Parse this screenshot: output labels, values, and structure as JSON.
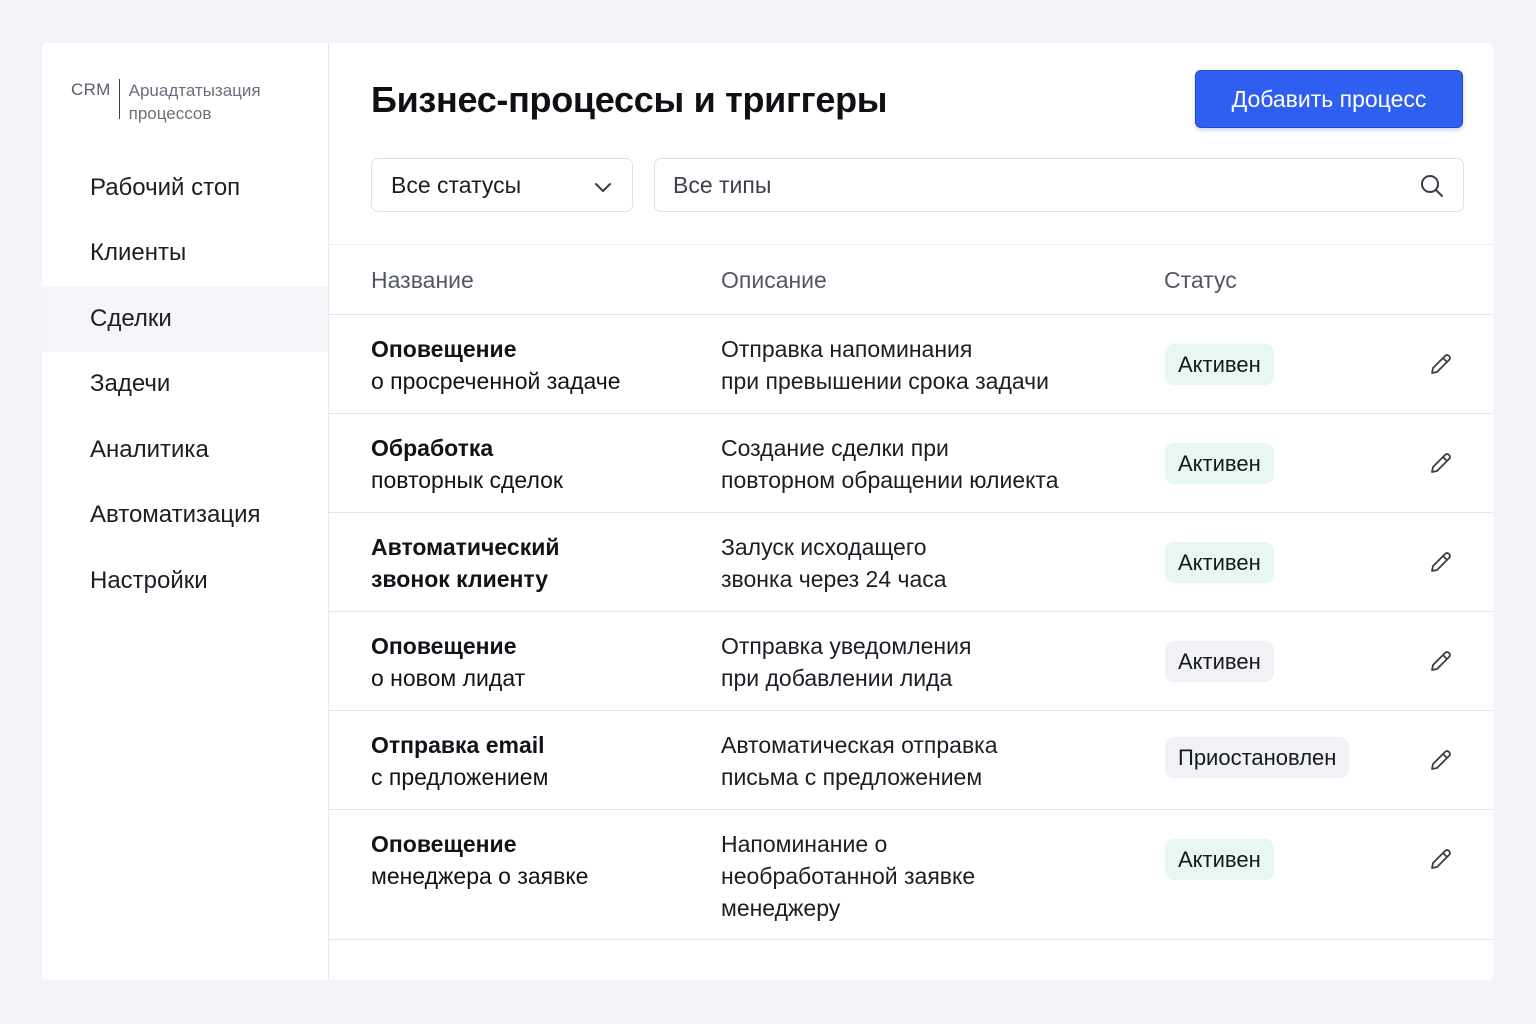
{
  "sidebar": {
    "brand": {
      "short": "CRM",
      "line1": "Арuадтатызация",
      "line2": "процессов"
    },
    "items": [
      {
        "label": "Рабочий стоп",
        "active": false
      },
      {
        "label": "Клиенты",
        "active": false
      },
      {
        "label": "Сделки",
        "active": true
      },
      {
        "label": "Задечи",
        "active": false
      },
      {
        "label": "Аналитика",
        "active": false
      },
      {
        "label": "Автоматизация",
        "active": false
      },
      {
        "label": "Настройки",
        "active": false
      }
    ]
  },
  "header": {
    "title": "Бизнес-процессы и триггеры",
    "add_button": "Добавить процесс"
  },
  "filters": {
    "status_select": "Все статусы",
    "type_search_placeholder": "Все типы"
  },
  "table": {
    "columns": {
      "name": "Название",
      "description": "Описание",
      "status": "Статус"
    },
    "rows": [
      {
        "name": [
          "Оповещение",
          "о просреченной задаче"
        ],
        "desc": [
          "Отправка напоминания",
          "при превышении срока задачи"
        ],
        "status": "Активен",
        "status_tone": "active"
      },
      {
        "name": [
          "Обработка",
          "повторнык сделок"
        ],
        "desc": [
          "Создание сделки при",
          "повторном обращении юлиекта"
        ],
        "status": "Активен",
        "status_tone": "active"
      },
      {
        "name": [
          "Автоматический",
          "звонок клиенту"
        ],
        "desc": [
          "Залуск исходащего",
          "звонка через 24 часа"
        ],
        "status": "Активен",
        "status_tone": "active"
      },
      {
        "name": [
          "Оповещение",
          "о новом лидат"
        ],
        "desc": [
          "Отправка уведомления",
          "при добавлении лида"
        ],
        "status": "Активен",
        "status_tone": "neutral"
      },
      {
        "name": [
          "Отправка email",
          "с предложением"
        ],
        "desc": [
          "Автоматическая отправка",
          "письма с предложением"
        ],
        "status": "Приостановлен",
        "status_tone": "neutral"
      },
      {
        "name": [
          "Оповещение",
          "менеджера о заявке"
        ],
        "desc": [
          "Напоминание о",
          "необработанной заявке",
          "менеджеру"
        ],
        "status": "Активен",
        "status_tone": "active"
      }
    ]
  },
  "icons": {
    "chevron": "chevron-down-icon",
    "search": "search-icon",
    "edit": "pencil-icon"
  },
  "colors": {
    "accent": "#2f5ff0",
    "badge_active": "#e6f8ef",
    "badge_neutral": "#f1f2f6"
  }
}
